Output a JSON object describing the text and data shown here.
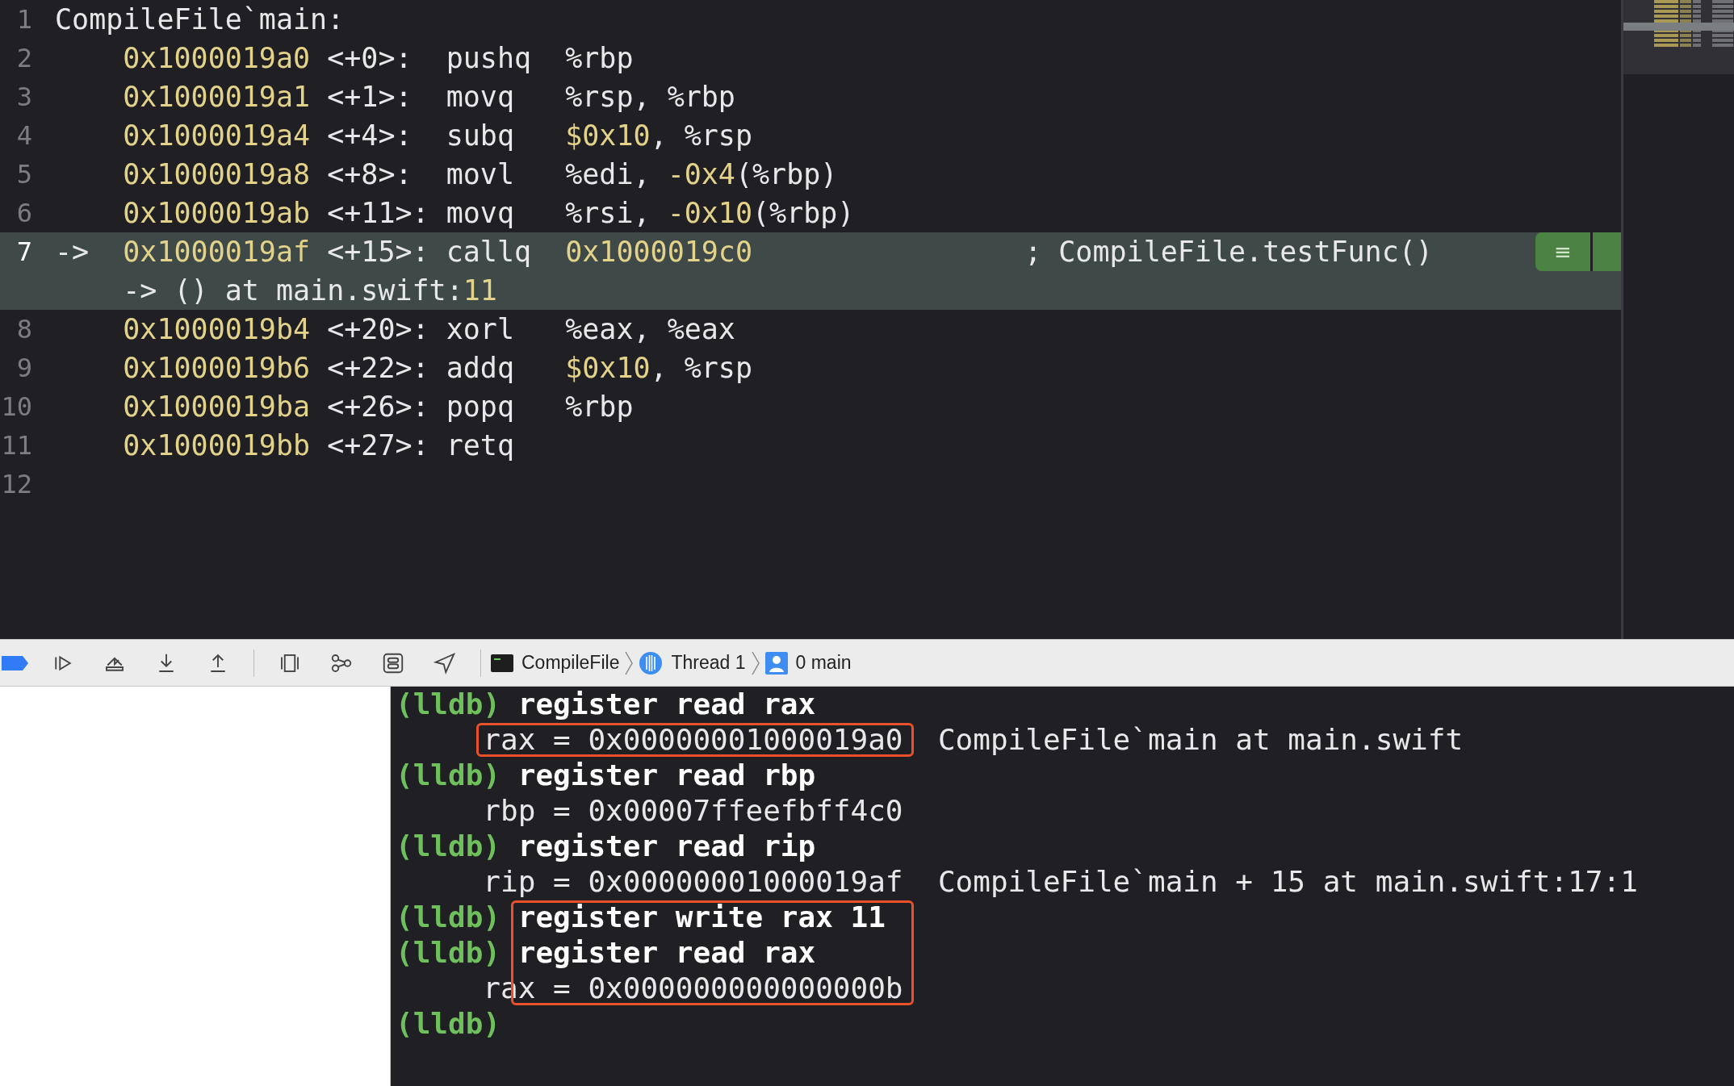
{
  "editor": {
    "lines": [
      {
        "number": "1",
        "kind": "label",
        "text": "CompileFile`main:"
      },
      {
        "number": "2",
        "kind": "instr",
        "current": false,
        "address": "0x1000019a0",
        "offset": "<+0>:",
        "mnemonic": "pushq",
        "operands": [
          {
            "kind": "plain",
            "text": "%rbp"
          }
        ]
      },
      {
        "number": "3",
        "kind": "instr",
        "current": false,
        "address": "0x1000019a1",
        "offset": "<+1>:",
        "mnemonic": "movq",
        "operands": [
          {
            "kind": "plain",
            "text": "%rsp, %rbp"
          }
        ]
      },
      {
        "number": "4",
        "kind": "instr",
        "current": false,
        "address": "0x1000019a4",
        "offset": "<+4>:",
        "mnemonic": "subq",
        "operands": [
          {
            "kind": "number",
            "text": "$0x10"
          },
          {
            "kind": "plain",
            "text": ", %rsp"
          }
        ]
      },
      {
        "number": "5",
        "kind": "instr",
        "current": false,
        "address": "0x1000019a8",
        "offset": "<+8>:",
        "mnemonic": "movl",
        "operands": [
          {
            "kind": "plain",
            "text": "%edi, "
          },
          {
            "kind": "number",
            "text": "-0x4"
          },
          {
            "kind": "plain",
            "text": "(%rbp)"
          }
        ]
      },
      {
        "number": "6",
        "kind": "instr",
        "current": false,
        "address": "0x1000019ab",
        "offset": "<+11>:",
        "mnemonic": "movq",
        "operands": [
          {
            "kind": "plain",
            "text": "%rsi, "
          },
          {
            "kind": "number",
            "text": "-0x10"
          },
          {
            "kind": "plain",
            "text": "(%rbp)"
          }
        ]
      },
      {
        "number": "7",
        "kind": "instr",
        "current": true,
        "arrow": "->",
        "address": "0x1000019af",
        "offset": "<+15>:",
        "mnemonic": "callq",
        "operands": [
          {
            "kind": "number",
            "text": "0x1000019c0"
          }
        ],
        "comment": "; CompileFile.testFunc()",
        "continuation": [
          {
            "kind": "plain",
            "text": "-> () at main.swift:"
          },
          {
            "kind": "number",
            "text": "11"
          }
        ],
        "badge": "≡"
      },
      {
        "number": "8",
        "kind": "instr",
        "current": false,
        "address": "0x1000019b4",
        "offset": "<+20>:",
        "mnemonic": "xorl",
        "operands": [
          {
            "kind": "plain",
            "text": "%eax, %eax"
          }
        ]
      },
      {
        "number": "9",
        "kind": "instr",
        "current": false,
        "address": "0x1000019b6",
        "offset": "<+22>:",
        "mnemonic": "addq",
        "operands": [
          {
            "kind": "number",
            "text": "$0x10"
          },
          {
            "kind": "plain",
            "text": ", %rsp"
          }
        ]
      },
      {
        "number": "10",
        "kind": "instr",
        "current": false,
        "address": "0x1000019ba",
        "offset": "<+26>:",
        "mnemonic": "popq",
        "operands": [
          {
            "kind": "plain",
            "text": "%rbp"
          }
        ]
      },
      {
        "number": "11",
        "kind": "instr",
        "current": false,
        "address": "0x1000019bb",
        "offset": "<+27>:",
        "mnemonic": "retq"
      },
      {
        "number": "12",
        "kind": "blank"
      }
    ]
  },
  "debug_bar": {
    "breadcrumbs": [
      {
        "kind": "process",
        "label": "CompileFile"
      },
      {
        "kind": "thread",
        "label": "Thread 1"
      },
      {
        "kind": "frame",
        "label": "0 main"
      }
    ]
  },
  "console": {
    "lines": [
      {
        "kind": "command",
        "prompt": "(lldb)",
        "text": "register read rax",
        "boxed": false
      },
      {
        "kind": "output",
        "text": "rax = 0x00000001000019a0",
        "note": "CompileFile`main at main.swift",
        "boxed": true
      },
      {
        "kind": "command",
        "prompt": "(lldb)",
        "text": "register read rbp",
        "boxed": false
      },
      {
        "kind": "output",
        "text": "rbp = 0x00007ffeefbff4c0",
        "boxed": false
      },
      {
        "kind": "command",
        "prompt": "(lldb)",
        "text": "register read rip",
        "boxed": false
      },
      {
        "kind": "output",
        "text": "rip = 0x00000001000019af",
        "note": "CompileFile`main + 15 at main.swift:17:1",
        "boxed": false
      },
      {
        "kind": "command",
        "prompt": "(lldb)",
        "text": "register write rax 11",
        "boxed": true
      },
      {
        "kind": "command",
        "prompt": "(lldb)",
        "text": "register read rax",
        "boxed": true
      },
      {
        "kind": "output",
        "text": "rax = 0x000000000000000b",
        "boxed": true
      },
      {
        "kind": "command",
        "prompt": "(lldb)",
        "boxed": false
      }
    ]
  }
}
